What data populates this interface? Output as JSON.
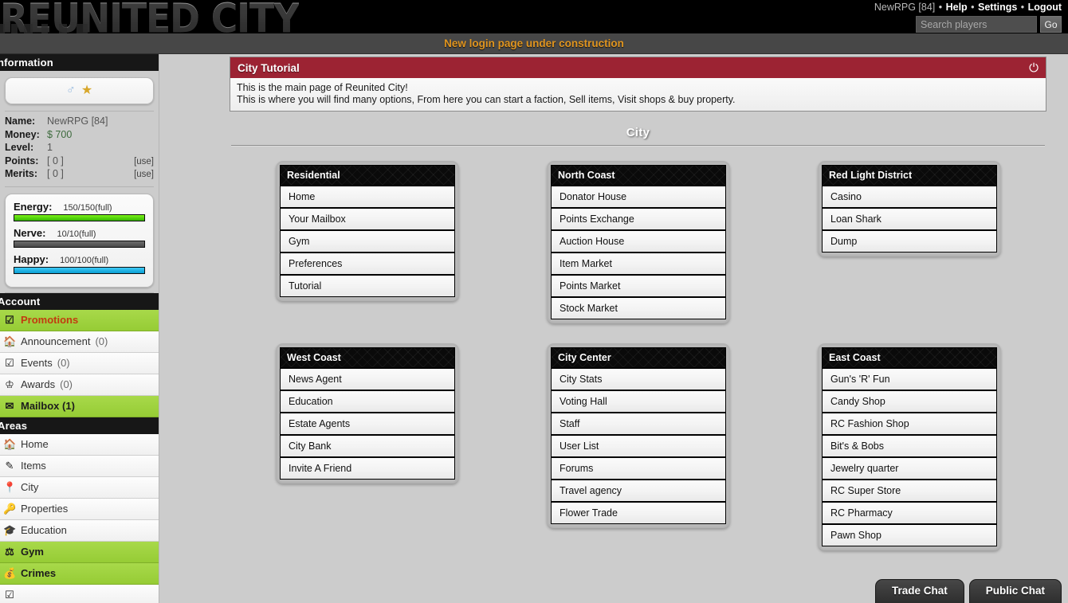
{
  "header": {
    "logo_text": "REUNITED CITY",
    "user_name": "NewRPG [84]",
    "links": [
      "Help",
      "Settings",
      "Logout"
    ],
    "search_placeholder": "Search players",
    "search_value": "",
    "go_label": "Go"
  },
  "notice": {
    "text": "New login page under construction"
  },
  "sidebar": {
    "information_header": "nformation",
    "avatar": {
      "gender_icon": "male-symbol",
      "rank_icon": "gold-star"
    },
    "stats": [
      {
        "label": "Name:",
        "value": "NewRPG [84]",
        "action": ""
      },
      {
        "label": "Money:",
        "value": "$ 700",
        "action": ""
      },
      {
        "label": "Level:",
        "value": "1",
        "action": ""
      },
      {
        "label": "Points:",
        "value": "[ 0 ]",
        "action": "[use]"
      },
      {
        "label": "Merits:",
        "value": "[ 0 ]",
        "action": "[use]"
      }
    ],
    "bars": [
      {
        "name": "Energy:",
        "value": "150/150(full)",
        "percent": 100,
        "color": "#4fd309"
      },
      {
        "name": "Nerve:",
        "value": "10/10(full)",
        "percent": 100,
        "color": "#585858"
      },
      {
        "name": "Happy:",
        "value": "100/100(full)",
        "percent": 100,
        "color": "#17b0e0"
      }
    ],
    "account_header": "Account",
    "account_items": [
      {
        "icon": "checkbox-icon",
        "label": "Promotions",
        "count": "",
        "highlight": true,
        "promo": true
      },
      {
        "icon": "home-icon",
        "label": "Announcement",
        "count": "(0)",
        "highlight": false,
        "promo": false
      },
      {
        "icon": "calendar-check-icon",
        "label": "Events",
        "count": "(0)",
        "highlight": false,
        "promo": false
      },
      {
        "icon": "awards-icon",
        "label": "Awards",
        "count": "(0)",
        "highlight": false,
        "promo": false
      },
      {
        "icon": "envelope-icon",
        "label": "Mailbox (1)",
        "count": "",
        "highlight": true,
        "promo": false
      }
    ],
    "areas_header": "Areas",
    "areas_items": [
      {
        "icon": "home-icon",
        "label": "Home",
        "highlight": false
      },
      {
        "icon": "pencil-icon",
        "label": "Items",
        "highlight": false
      },
      {
        "icon": "map-pin-icon",
        "label": "City",
        "highlight": false
      },
      {
        "icon": "key-icon",
        "label": "Properties",
        "highlight": false
      },
      {
        "icon": "graduation-cap-icon",
        "label": "Education",
        "highlight": false
      },
      {
        "icon": "dumbbell-icon",
        "label": "Gym",
        "highlight": true
      },
      {
        "icon": "money-bag-icon",
        "label": "Crimes",
        "highlight": true
      }
    ]
  },
  "tutorial": {
    "title": "City Tutorial",
    "close_icon": "power-icon",
    "line1": "This is the main page of Reunited City!",
    "line2": "This is where you will find many options, From here you can start a faction, Sell items, Visit shops & buy property."
  },
  "main": {
    "page_title": "City",
    "districts": [
      {
        "title": "Residential",
        "items": [
          "Home",
          "Your Mailbox",
          "Gym",
          "Preferences",
          "Tutorial"
        ]
      },
      {
        "title": "North Coast",
        "items": [
          "Donator House",
          "Points Exchange",
          "Auction House",
          "Item Market",
          "Points Market",
          "Stock Market"
        ]
      },
      {
        "title": "Red Light District",
        "items": [
          "Casino",
          "Loan Shark",
          "Dump"
        ]
      },
      {
        "title": "West Coast",
        "items": [
          "News Agent",
          "Education",
          "Estate Agents",
          "City Bank",
          "Invite A Friend"
        ]
      },
      {
        "title": "City Center",
        "items": [
          "City Stats",
          "Voting Hall",
          "Staff",
          "User List",
          "Forums",
          "Travel agency",
          "Flower Trade"
        ]
      },
      {
        "title": "East Coast",
        "items": [
          "Gun's 'R' Fun",
          "Candy Shop",
          "RC Fashion Shop",
          "Bit's & Bobs",
          "Jewelry quarter",
          "RC Super Store",
          "RC Pharmacy",
          "Pawn Shop"
        ]
      }
    ]
  },
  "chat_tabs": [
    {
      "label": "Trade Chat"
    },
    {
      "label": "Public Chat"
    }
  ],
  "colors": {
    "page_background": "#cccccc",
    "header_background": "#000000",
    "notice_text": "#e0951f",
    "tutorial_header": "#9c2333",
    "highlight_green": "#a0d241",
    "promo_red": "#c23b10"
  }
}
